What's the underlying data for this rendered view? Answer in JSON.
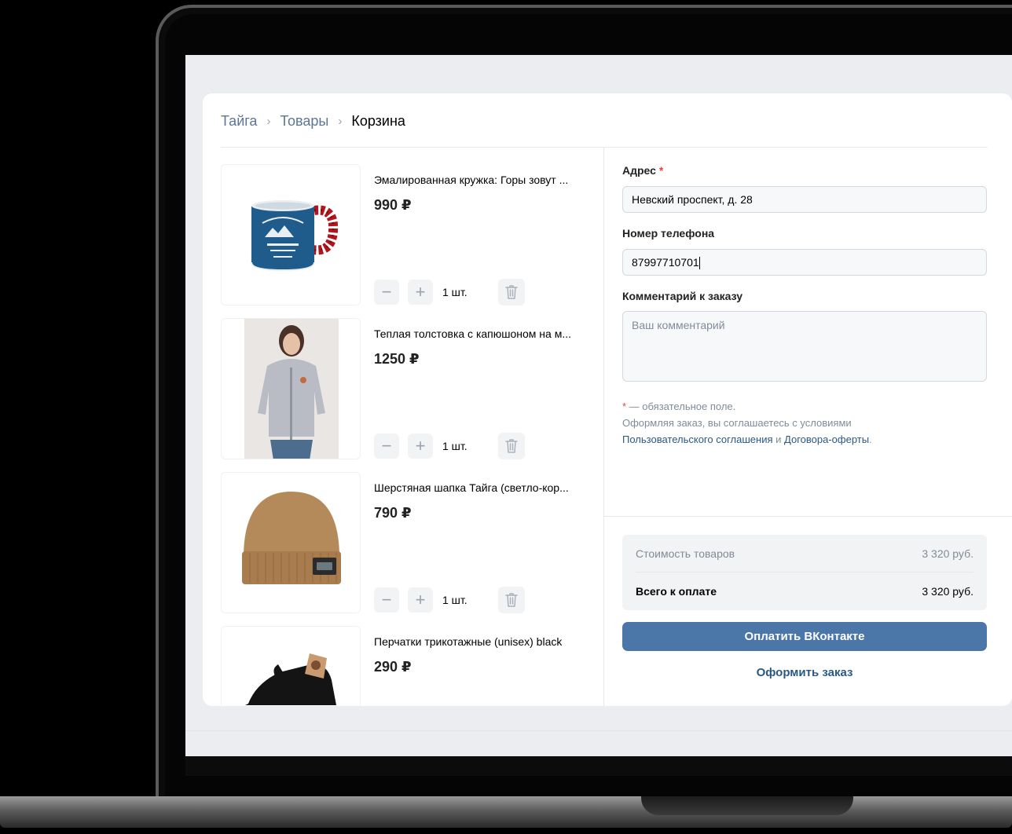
{
  "breadcrumb": {
    "items": [
      "Тайга",
      "Товары"
    ],
    "current": "Корзина",
    "separator": "›"
  },
  "cart": {
    "items": [
      {
        "title": "Эмалированная кружка: Горы зовут ...",
        "price": "990 ₽",
        "qty": "1 шт.",
        "image": "enamel-mug"
      },
      {
        "title": "Теплая толстовка с капюшоном на м...",
        "price": "1250 ₽",
        "qty": "1 шт.",
        "image": "hoodie"
      },
      {
        "title": "Шерстяная шапка Тайга (светло-кор...",
        "price": "790 ₽",
        "qty": "1 шт.",
        "image": "beanie"
      },
      {
        "title": "Перчатки трикотажные (unisex) black",
        "price": "290 ₽",
        "qty": "",
        "image": "gloves"
      }
    ],
    "minus_symbol": "−",
    "plus_symbol": "+"
  },
  "form": {
    "address_label": "Адрес",
    "address_value": "Невский проспект, д. 28",
    "required_mark": "*",
    "phone_label": "Номер телефона",
    "phone_value": "87997710701",
    "comment_label": "Комментарий к заказу",
    "comment_placeholder": "Ваш комментарий",
    "note_required": "* — обязательное поле.",
    "note_agree": "Оформляя заказ, вы соглашаетесь с условиями",
    "link_terms": "Пользовательского соглашения",
    "note_and": "и",
    "link_offer": "Договора-оферты",
    "note_end": "."
  },
  "summary": {
    "goods_label": "Стоимость товаров",
    "goods_value": "3 320 руб.",
    "total_label": "Всего к оплате",
    "total_value": "3 320 руб."
  },
  "actions": {
    "pay_label": "Оплатить ВКонтакте",
    "order_label": "Оформить заказ"
  },
  "colors": {
    "accent": "#4a76a8",
    "link": "#2a5885",
    "required": "#e64646"
  }
}
